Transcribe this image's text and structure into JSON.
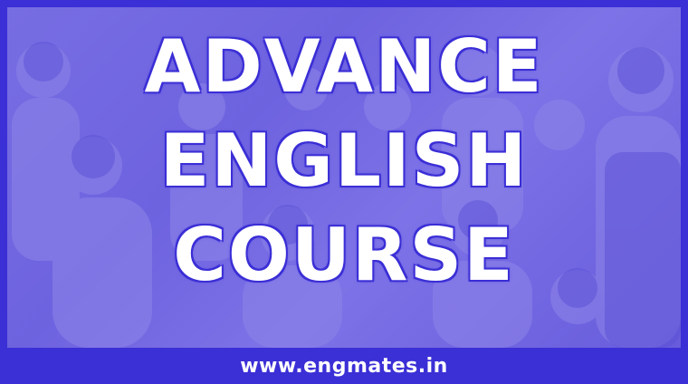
{
  "headline": {
    "line1": "ADVANCE",
    "line2": "ENGLISH",
    "line3": "COURSE"
  },
  "footer": {
    "url": "www.engmates.in"
  },
  "colors": {
    "frame": "#3b2fd6",
    "overlay": "#7e73e2",
    "text": "#ffffff"
  }
}
